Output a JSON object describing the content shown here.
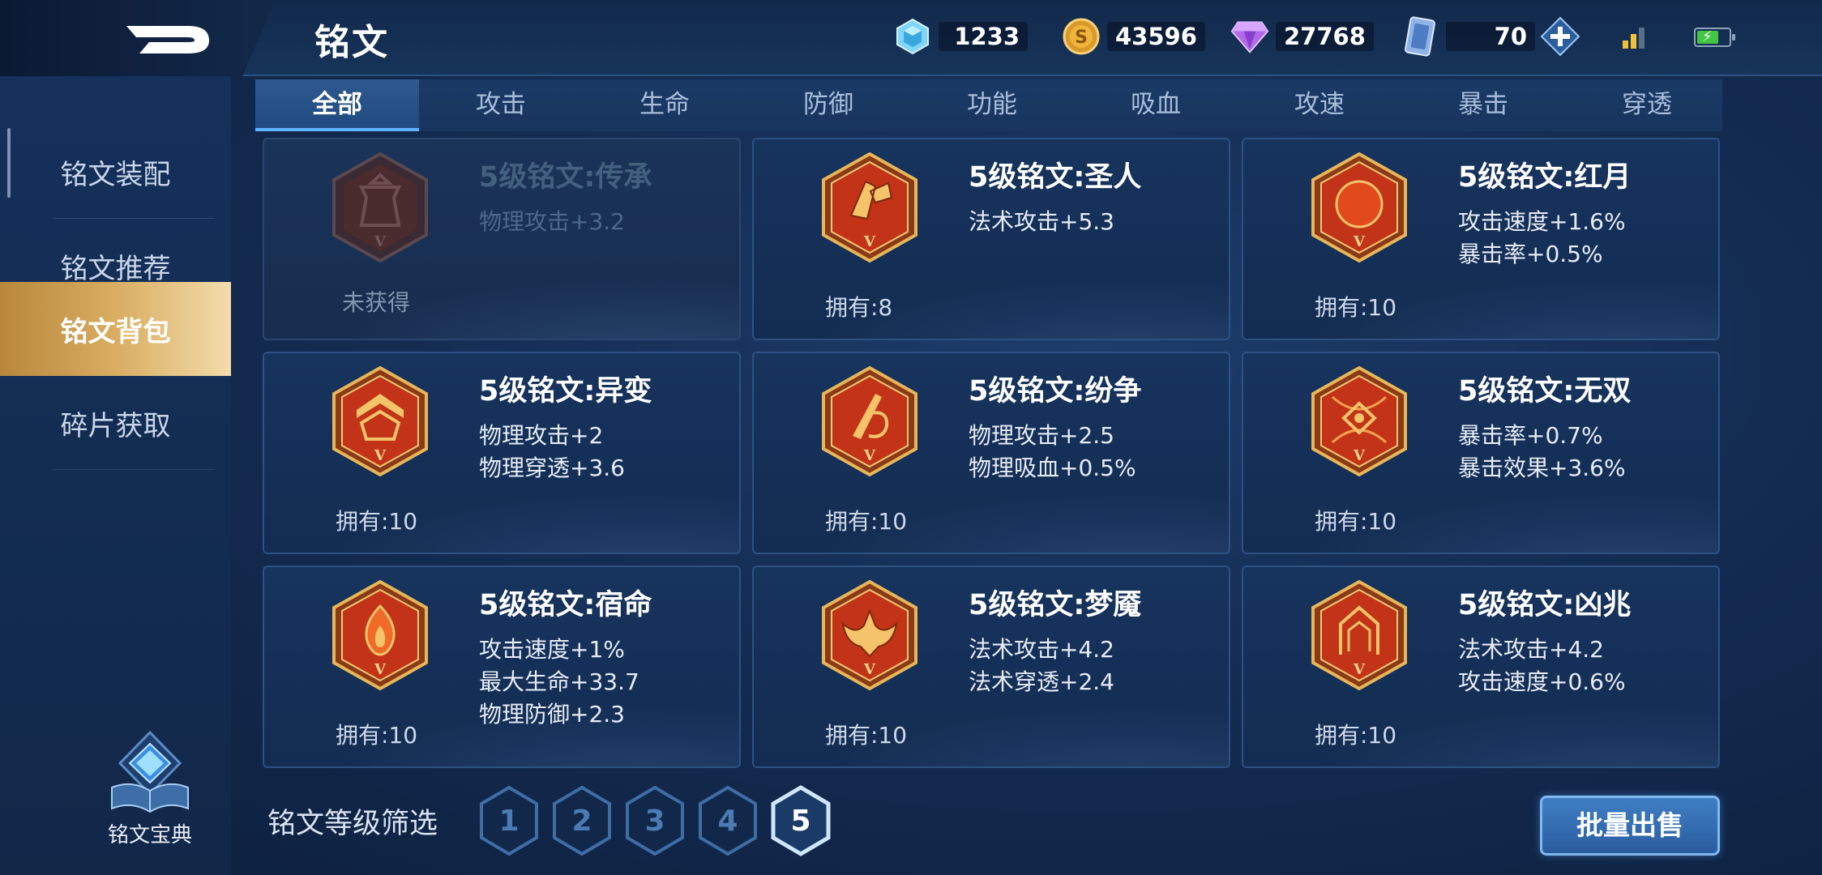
{
  "header": {
    "title": "铭文",
    "currencies": [
      {
        "name": "diamond-gem",
        "value": "1233"
      },
      {
        "name": "gold-coin",
        "value": "43596"
      },
      {
        "name": "purple-crystal",
        "value": "27768"
      },
      {
        "name": "ticket-card",
        "value": "70"
      }
    ]
  },
  "sidebar": {
    "items": [
      {
        "label": "铭文装配",
        "active": false
      },
      {
        "label": "铭文推荐",
        "active": false
      },
      {
        "label": "铭文背包",
        "active": true
      },
      {
        "label": "碎片获取",
        "active": false
      }
    ],
    "codex_label": "铭文宝典"
  },
  "tabs": [
    {
      "label": "全部",
      "active": true
    },
    {
      "label": "攻击",
      "active": false
    },
    {
      "label": "生命",
      "active": false
    },
    {
      "label": "防御",
      "active": false
    },
    {
      "label": "功能",
      "active": false
    },
    {
      "label": "吸血",
      "active": false
    },
    {
      "label": "攻速",
      "active": false
    },
    {
      "label": "暴击",
      "active": false
    },
    {
      "label": "穿透",
      "active": false
    }
  ],
  "runes": [
    {
      "name": "5级铭文:传承",
      "attrs": [
        "物理攻击+3.2"
      ],
      "owned": "未获得",
      "locked": true,
      "icon": "chuancheng-emblem-icon"
    },
    {
      "name": "5级铭文:圣人",
      "attrs": [
        "法术攻击+5.3"
      ],
      "owned": "拥有:8",
      "locked": false,
      "icon": "shengren-emblem-icon"
    },
    {
      "name": "5级铭文:红月",
      "attrs": [
        "攻击速度+1.6%",
        "暴击率+0.5%"
      ],
      "owned": "拥有:10",
      "locked": false,
      "icon": "hongyue-emblem-icon"
    },
    {
      "name": "5级铭文:异变",
      "attrs": [
        "物理攻击+2",
        "物理穿透+3.6"
      ],
      "owned": "拥有:10",
      "locked": false,
      "icon": "yibian-emblem-icon"
    },
    {
      "name": "5级铭文:纷争",
      "attrs": [
        "物理攻击+2.5",
        "物理吸血+0.5%"
      ],
      "owned": "拥有:10",
      "locked": false,
      "icon": "fenzheng-emblem-icon"
    },
    {
      "name": "5级铭文:无双",
      "attrs": [
        "暴击率+0.7%",
        "暴击效果+3.6%"
      ],
      "owned": "拥有:10",
      "locked": false,
      "icon": "wushuang-emblem-icon"
    },
    {
      "name": "5级铭文:宿命",
      "attrs": [
        "攻击速度+1%",
        "最大生命+33.7",
        "物理防御+2.3"
      ],
      "owned": "拥有:10",
      "locked": false,
      "icon": "suming-emblem-icon"
    },
    {
      "name": "5级铭文:梦魇",
      "attrs": [
        "法术攻击+4.2",
        "法术穿透+2.4"
      ],
      "owned": "拥有:10",
      "locked": false,
      "icon": "mengyan-emblem-icon"
    },
    {
      "name": "5级铭文:凶兆",
      "attrs": [
        "法术攻击+4.2",
        "攻击速度+0.6%"
      ],
      "owned": "拥有:10",
      "locked": false,
      "icon": "xiongzhao-emblem-icon"
    }
  ],
  "filter": {
    "label": "铭文等级筛选",
    "levels": [
      "1",
      "2",
      "3",
      "4",
      "5"
    ],
    "selected": "5"
  },
  "sell_button": "批量出售",
  "colors": {
    "accent_gold": "#d9ad62",
    "accent_blue": "#5fb4ff",
    "emblem_red": "#c23317",
    "emblem_gold": "#e7b65a"
  }
}
